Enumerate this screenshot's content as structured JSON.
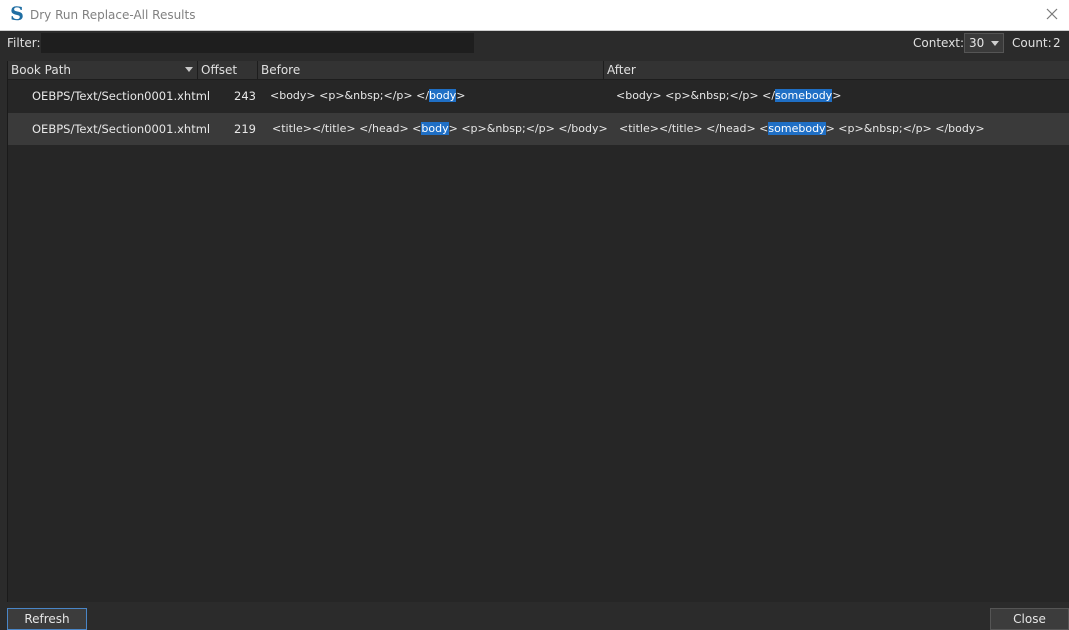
{
  "window": {
    "title": "Dry Run Replace-All Results",
    "logo": "S"
  },
  "toolbar": {
    "filter_label": "Filter:",
    "filter_value": "",
    "context_label": "Context:",
    "context_value": "30",
    "count_label": "Count:",
    "count_value": "2"
  },
  "table": {
    "columns": [
      "Book Path",
      "Offset",
      "Before",
      "After"
    ],
    "rows": [
      {
        "path": "OEBPS/Text/Section0001.xhtml",
        "offset": "243",
        "before_pre": "<body>  <p>&nbsp;</p> </",
        "before_match": "body",
        "before_post": ">",
        "after_pre": "<body>  <p>&nbsp;</p> </",
        "after_match": "somebody",
        "after_post": ">"
      },
      {
        "path": "OEBPS/Text/Section0001.xhtml",
        "offset": "219",
        "before_pre": "<title></title> </head> <",
        "before_match": "body",
        "before_post": ">  <p>&nbsp;</p> </body>",
        "after_pre": "<title></title> </head> <",
        "after_match": "somebody",
        "after_post": ">  <p>&nbsp;</p> </body>"
      }
    ]
  },
  "buttons": {
    "refresh": "Refresh",
    "close": "Close"
  },
  "colors": {
    "highlight": "#1f6fc5",
    "background": "#2b2b2b",
    "logo": "#1f6ea3"
  }
}
